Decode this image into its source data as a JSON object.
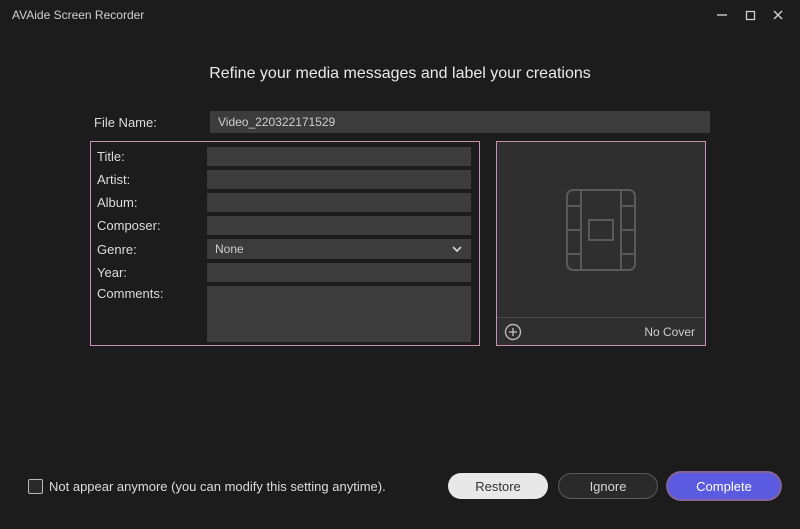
{
  "window": {
    "title": "AVAide Screen Recorder"
  },
  "heading": "Refine your media messages and label your creations",
  "file": {
    "label": "File Name:",
    "value": "Video_220322171529"
  },
  "meta": {
    "title": {
      "label": "Title:",
      "value": ""
    },
    "artist": {
      "label": "Artist:",
      "value": ""
    },
    "album": {
      "label": "Album:",
      "value": ""
    },
    "composer": {
      "label": "Composer:",
      "value": ""
    },
    "genre": {
      "label": "Genre:",
      "selected": "None"
    },
    "year": {
      "label": "Year:",
      "value": ""
    },
    "comments": {
      "label": "Comments:",
      "value": ""
    }
  },
  "cover": {
    "no_cover_text": "No Cover"
  },
  "footer": {
    "not_appear_label": "Not appear anymore (you can modify this setting anytime).",
    "not_appear_checked": false,
    "restore": "Restore",
    "ignore": "Ignore",
    "complete": "Complete"
  }
}
